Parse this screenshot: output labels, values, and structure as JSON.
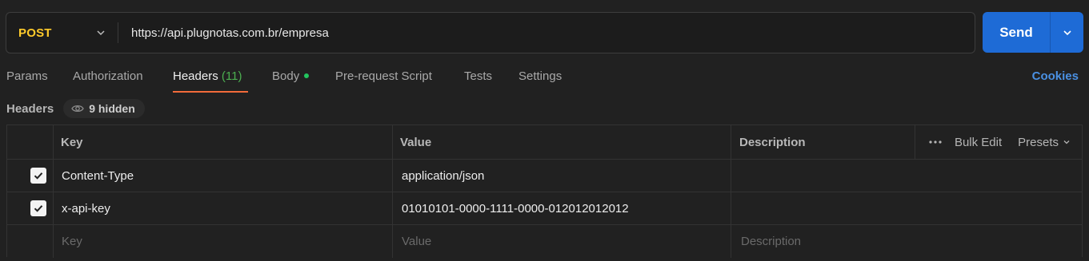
{
  "request": {
    "method": "POST",
    "url": "https://api.plugnotas.com.br/empresa",
    "send_label": "Send"
  },
  "tabs": [
    {
      "label": "Params"
    },
    {
      "label": "Authorization"
    },
    {
      "label": "Headers",
      "count": "(11)"
    },
    {
      "label": "Body"
    },
    {
      "label": "Pre-request Script"
    },
    {
      "label": "Tests"
    },
    {
      "label": "Settings"
    }
  ],
  "cookies_label": "Cookies",
  "headers_section": {
    "title": "Headers",
    "hidden_label": "9 hidden"
  },
  "table": {
    "columns": {
      "key": "Key",
      "value": "Value",
      "description": "Description"
    },
    "tools": {
      "bulk_edit": "Bulk Edit",
      "presets": "Presets"
    },
    "rows": [
      {
        "key": "Content-Type",
        "value": "application/json",
        "checked": true
      },
      {
        "key": "x-api-key",
        "value": "01010101-0000-1111-0000-012012012012",
        "checked": true
      }
    ],
    "placeholders": {
      "key": "Key",
      "value": "Value",
      "description": "Description"
    }
  },
  "colors": {
    "method": "#ffcb2b",
    "send": "#1e6bd6",
    "active_tab_underline": "#f26b3a",
    "body_dot": "#22c55e",
    "headers_count": "#4caf50",
    "cookies": "#4a90e2"
  }
}
